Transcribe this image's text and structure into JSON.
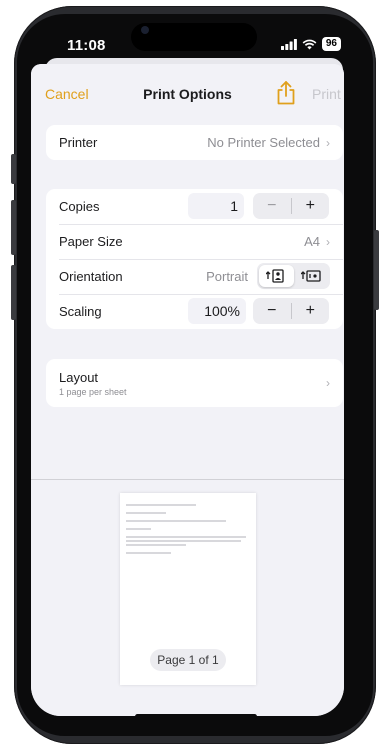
{
  "status": {
    "time": "11:08",
    "battery": "96"
  },
  "nav": {
    "cancel": "Cancel",
    "title": "Print Options",
    "print": "Print"
  },
  "printer": {
    "label": "Printer",
    "value": "No Printer Selected"
  },
  "copies": {
    "label": "Copies",
    "value": "1"
  },
  "paper_size": {
    "label": "Paper Size",
    "value": "A4"
  },
  "orientation": {
    "label": "Orientation",
    "value": "Portrait"
  },
  "scaling": {
    "label": "Scaling",
    "value": "100%"
  },
  "layout": {
    "label": "Layout",
    "subtitle": "1 page per sheet"
  },
  "preview": {
    "page_label": "Page 1 of 1"
  },
  "colors": {
    "accent": "#e0a01c",
    "background": "#f2f2f7"
  }
}
